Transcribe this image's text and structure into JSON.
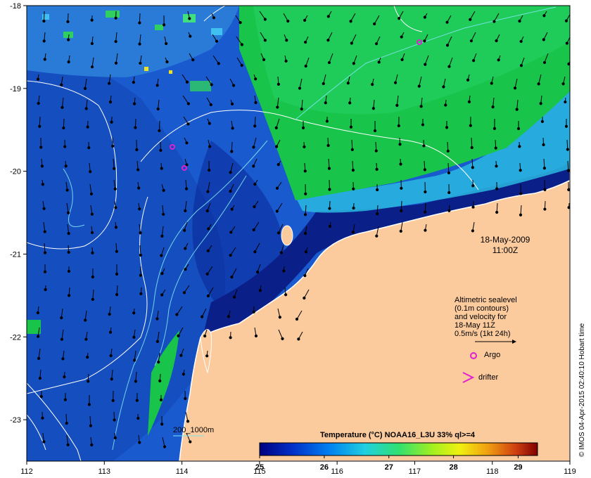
{
  "map": {
    "lon_ticks": [
      "112",
      "113",
      "114",
      "115",
      "116",
      "117",
      "118",
      "119"
    ],
    "lat_ticks": [
      "-18",
      "-19",
      "-20",
      "-21",
      "-22",
      "-23"
    ],
    "lon_range": [
      112,
      119
    ],
    "lat_range": [
      -23.5,
      -18
    ],
    "date_line1": "18-May-2009",
    "date_line2": "11:00Z",
    "legend_lines": [
      "Altimetric sealevel",
      "(0.1m contours)",
      "and velocity for",
      "18-May 11Z",
      "0.5m/s (1kt 24h)"
    ],
    "argo_label": "Argo",
    "drifter_label": "drifter",
    "depth_label": "200_1000m",
    "credit": "© IMOS 04-Apr-2015 02:40:10 Hobart time",
    "colors": {
      "land": "#fbcb9e",
      "deep_blue": "#0a2a9a",
      "mid_blue": "#1a5acf",
      "cyan": "#2ab8e0",
      "green": "#18c44a",
      "argo": "#e020d0",
      "contour": "#ffffff",
      "isobath": "#7fe6f0"
    }
  },
  "colorbar": {
    "title": "Temperature (°C) NOAA16_L3U 33% ql>=4",
    "ticks": [
      "25",
      "26",
      "27",
      "28",
      "29"
    ],
    "min": 25,
    "max": 29.3
  }
}
